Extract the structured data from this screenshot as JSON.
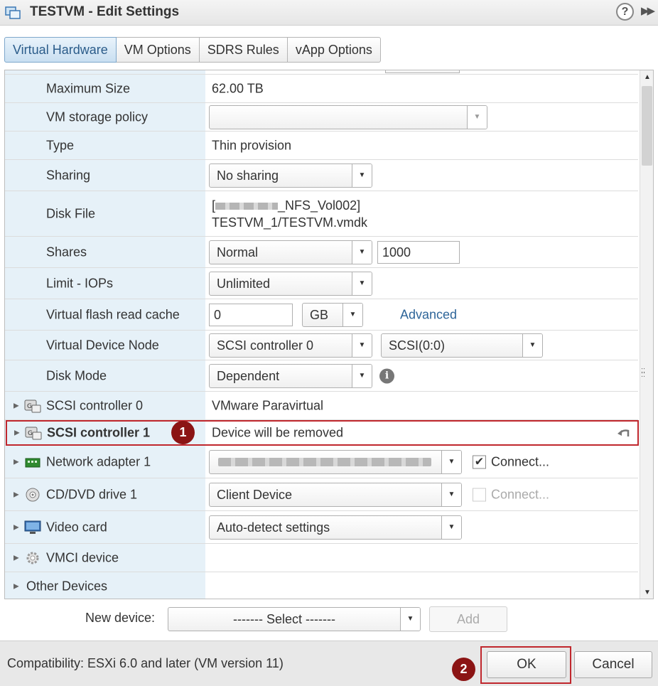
{
  "window": {
    "title": "TESTVM - Edit Settings",
    "help_label": "?",
    "expand_label": "▶▶"
  },
  "tabs": [
    {
      "label": "Virtual Hardware",
      "active": true
    },
    {
      "label": "VM Options",
      "active": false
    },
    {
      "label": "SDRS Rules",
      "active": false
    },
    {
      "label": "vApp Options",
      "active": false
    }
  ],
  "disk": {
    "maximum_size": {
      "label": "Maximum Size",
      "value": "62.00 TB"
    },
    "storage_policy": {
      "label": "VM storage policy",
      "value": ""
    },
    "type": {
      "label": "Type",
      "value": "Thin provision"
    },
    "sharing": {
      "label": "Sharing",
      "value": "No sharing"
    },
    "disk_file": {
      "label": "Disk File",
      "line1_suffix": "_NFS_Vol002]",
      "line1_prefix": "[",
      "line2": "TESTVM_1/TESTVM.vmdk"
    },
    "shares": {
      "label": "Shares",
      "level": "Normal",
      "value": "1000"
    },
    "limit_iops": {
      "label": "Limit - IOPs",
      "value": "Unlimited"
    },
    "flash_cache": {
      "label": "Virtual flash read cache",
      "value": "0",
      "unit": "GB",
      "advanced_link": "Advanced"
    },
    "device_node": {
      "label": "Virtual Device Node",
      "controller": "SCSI controller 0",
      "slot": "SCSI(0:0)"
    },
    "disk_mode": {
      "label": "Disk Mode",
      "value": "Dependent",
      "info_glyph": "i"
    }
  },
  "devices": [
    {
      "label": "SCSI controller 0",
      "value": "VMware Paravirtual",
      "icon": "scsi-controller-icon"
    },
    {
      "label": "SCSI controller 1",
      "value": "Device will be removed",
      "icon": "scsi-controller-icon",
      "badge": "1"
    },
    {
      "label": "Network adapter 1",
      "checkbox_label": "Connect...",
      "checked": true,
      "icon": "network-adapter-icon"
    },
    {
      "label": "CD/DVD drive 1",
      "value": "Client Device",
      "checkbox_label": "Connect...",
      "checked": false,
      "icon": "cd-dvd-icon"
    },
    {
      "label": "Video card",
      "value": "Auto-detect settings",
      "icon": "video-card-icon"
    },
    {
      "label": "VMCI device",
      "icon": "vmci-device-icon"
    },
    {
      "label": "Other Devices"
    }
  ],
  "new_device": {
    "label": "New device:",
    "select_value": "------- Select -------",
    "add_label": "Add"
  },
  "footer": {
    "compatibility": "Compatibility: ESXi 6.0 and later (VM version 11)",
    "ok_label": "OK",
    "ok_badge": "2",
    "cancel_label": "Cancel"
  },
  "colors": {
    "highlight": "#c0272d",
    "badge": "#8b1414",
    "label_column": "#e6f1f8",
    "link": "#2e6599"
  }
}
